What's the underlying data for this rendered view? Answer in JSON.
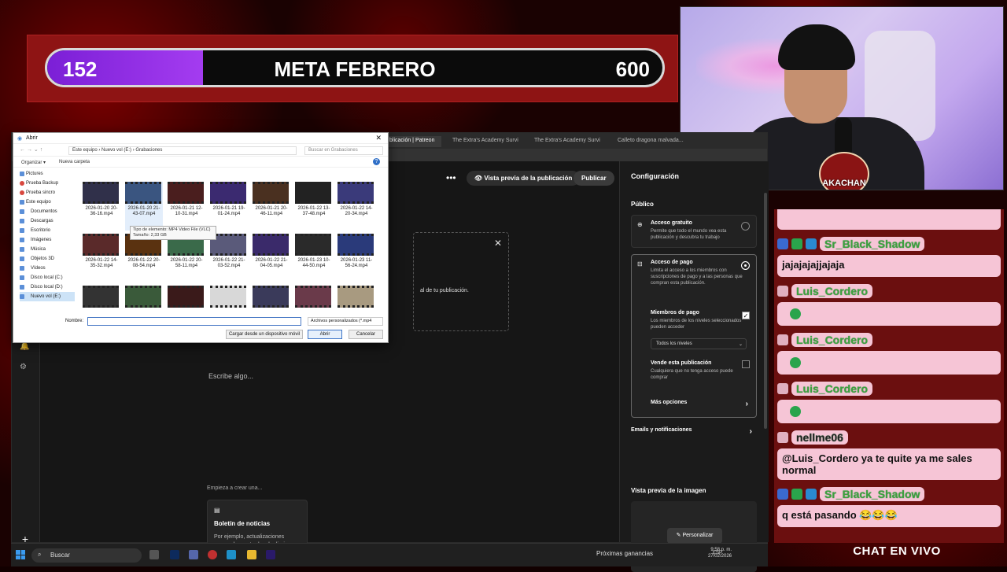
{
  "goal": {
    "current": "152",
    "title": "META FEBRERO",
    "target": "600",
    "progress_fraction": 0.253
  },
  "webcam": {
    "logo_text": "AKACHAN",
    "logo_sub": "NACION"
  },
  "chat": {
    "title": "CHAT EN VIVO",
    "messages": [
      {
        "user": "Sr_Black_Shadow",
        "text": "jajajajajjajaja"
      },
      {
        "user": "Luis_Cordero",
        "text": ""
      },
      {
        "user": "Luis_Cordero",
        "text": ""
      },
      {
        "user": "Luis_Cordero",
        "text": ""
      },
      {
        "user": "nellme06",
        "text": "@Luis_Cordero ya te quite ya me sales normal"
      },
      {
        "user": "Sr_Black_Shadow",
        "text": "q está pasando 😂😂😂"
      }
    ]
  },
  "browser": {
    "tabs": [
      {
        "label": "blicación | Patreon",
        "active": true
      },
      {
        "label": "The Extra's Academy Surviv...",
        "active": false
      },
      {
        "label": "The Extra's Academy Surviv...",
        "active": false
      },
      {
        "label": "Calleto dragona malvada...",
        "active": false
      }
    ]
  },
  "patreon": {
    "preview_button": "Vista previa de la publicación",
    "publish_button": "Publicar",
    "more_icon": "more-horizontal-icon",
    "drop_hint": "al de tu publicación.",
    "compose_placeholder": "Escribe algo...",
    "start_label": "Empieza a crear una...",
    "card": {
      "title": "Boletín de noticias",
      "desc": "Por ejemplo, actualizaciones semanales, entradas de diario, análisis a fondo exclusivos"
    },
    "config": {
      "title": "Configuración",
      "audience_section": "Público",
      "free": {
        "title": "Acceso gratuito",
        "desc": "Permite que todo el mundo vea esta publicación y descubra tu trabajo"
      },
      "paid": {
        "title": "Acceso de pago",
        "desc": "Limita el acceso a los miembros con suscripciones de pago y a las personas que compran esta publicación."
      },
      "members": {
        "title": "Miembros de pago",
        "desc": "Los miembros de los niveles seleccionados pueden acceder",
        "select": "Todos los niveles"
      },
      "sell": {
        "title": "Vende esta publicación",
        "desc": "Cualquiera que no tenga acceso puede comprar"
      },
      "more_options": "Más opciones",
      "emails": "Emails y notificaciones",
      "image_preview": "Vista previa de la imagen",
      "customize": "Personalizar"
    }
  },
  "dialog": {
    "title": "Abrir",
    "breadcrumb": "Este equipo  ›  Nuevo vol (E:)  ›  Grabaciones",
    "search_placeholder": "Buscar en Grabaciones",
    "organize": "Organizar ▾",
    "new_folder": "Nueva carpeta",
    "tree": [
      "Pictures",
      "Prueba Backup",
      "Prueba sincro",
      "Este equipo",
      "Documentos",
      "Descargas",
      "Escritorio",
      "Imágenes",
      "Música",
      "Objetos 3D",
      "Vídeos",
      "Disco local (C:)",
      "Disco local (D:)",
      "Nuevo vol (E:)"
    ],
    "files": [
      "2026-01-20 20-36-16.mp4",
      "2026-01-20 21-43-07.mp4",
      "2026-01-21 12-10-31.mp4",
      "2026-01-21 19-01-24.mp4",
      "2026-01-21 20-46-11.mp4",
      "2026-01-22 13-37-48.mp4",
      "2026-01-22 14-20-34.mp4",
      "2026-01-22 14-35-32.mp4",
      "2026-01-22 20-08-54.mp4",
      "2026-01-22 20-58-11.mp4",
      "2026-01-22 21-03-52.mp4",
      "2026-01-22 21-04-05.mp4",
      "2026-01-23 10-44-50.mp4",
      "2026-01-23 11-56-24.mp4",
      "",
      "",
      "",
      "",
      "",
      "",
      ""
    ],
    "tooltip": "Tipo de elemento: MP4 Video File (VLC) Tamaño: 2,33 GB",
    "name_label": "Nombre:",
    "filter": "Archivos personalizados (*.mp4",
    "upload_device": "Cargar desde un dispositivo móvil",
    "open": "Abrir",
    "cancel": "Cancelar"
  },
  "taskbar": {
    "search": "Buscar",
    "earnings": "Próximas ganancias",
    "lang": "ESP",
    "time": "9:58 p. m.",
    "date": "27/02/2026"
  }
}
